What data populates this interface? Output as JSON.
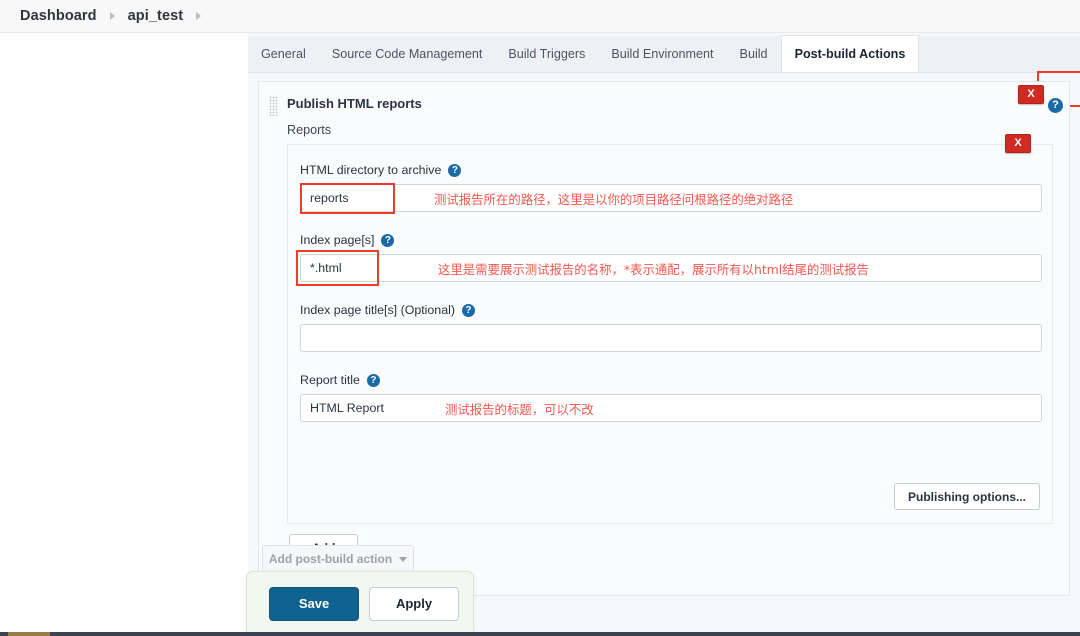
{
  "breadcrumb": {
    "items": [
      {
        "label": "Dashboard"
      },
      {
        "label": "api_test"
      }
    ]
  },
  "tabs": [
    {
      "label": "General",
      "active": false
    },
    {
      "label": "Source Code Management",
      "active": false
    },
    {
      "label": "Build Triggers",
      "active": false
    },
    {
      "label": "Build Environment",
      "active": false
    },
    {
      "label": "Build",
      "active": false
    },
    {
      "label": "Post-build Actions",
      "active": true
    }
  ],
  "panel": {
    "title": "Publish HTML reports",
    "reports_label": "Reports",
    "remove_label": "X",
    "help_label": "?"
  },
  "fields": {
    "html_dir": {
      "label": "HTML directory to archive",
      "value": "reports",
      "note": "测试报告所在的路径，这里是以你的项目路径问根路径的绝对路径"
    },
    "index_pages": {
      "label": "Index page[s]",
      "value": "*.html",
      "note": "这里是需要展示测试报告的名称，*表示通配，展示所有以html结尾的测试报告"
    },
    "index_page_titles": {
      "label": "Index page title[s] (Optional)",
      "value": ""
    },
    "report_title": {
      "label": "Report title",
      "value": "HTML Report",
      "note": "测试报告的标题，可以不改"
    }
  },
  "buttons": {
    "publishing_options": "Publishing options...",
    "add": "Add",
    "add_post_build_action": "Add post-build action",
    "save": "Save",
    "apply": "Apply"
  },
  "colors": {
    "accent_blue": "#11638f",
    "danger_red": "#d12a22",
    "annotation_red": "#f3584f",
    "highlight_red": "#ef3b2d",
    "help_blue": "#1b6aa5"
  }
}
